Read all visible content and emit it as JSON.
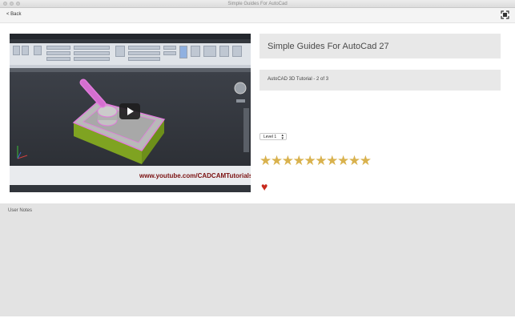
{
  "window": {
    "title": "Simple Guides For AutoCad"
  },
  "nav": {
    "back_label": "< Back"
  },
  "video": {
    "watermark": "www.youtube.com/CADCAMTutorials",
    "colors": {
      "solid_top": "#b9b9b9",
      "solid_side": "#7fa321",
      "highlight": "#e27bdc"
    }
  },
  "app": {
    "title": "Simple Guides For AutoCad 27",
    "lesson": "AutoCAD 3D Tutorial - 2 of 3",
    "level": "Level 1",
    "rating": {
      "stars": 10
    },
    "star_color": "#d9b24e",
    "heart_color": "#c8291c"
  },
  "notes": {
    "label": "User Notes"
  }
}
